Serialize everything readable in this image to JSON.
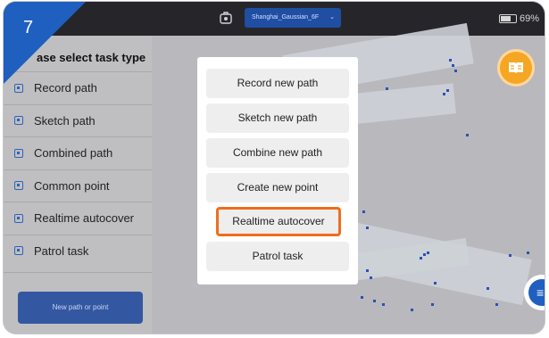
{
  "step_badge": "7",
  "topbar": {
    "map_icon": "robot-map-icon",
    "map_name": "Shanghai_Gaussian_6F",
    "battery_text": "69%"
  },
  "sidebar": {
    "header": "ase select task type",
    "items": [
      {
        "label": "Record path",
        "icon": "task-icon"
      },
      {
        "label": "Sketch path",
        "icon": "task-icon"
      },
      {
        "label": "Combined path",
        "icon": "task-icon"
      },
      {
        "label": "Common point",
        "icon": "task-icon"
      },
      {
        "label": "Realtime autocover",
        "icon": "task-icon"
      },
      {
        "label": "Patrol task",
        "icon": "task-icon"
      }
    ],
    "new_button": "New path or point"
  },
  "modal": {
    "options": [
      "Record new path",
      "Sketch new path",
      "Combine new path",
      "Create new point",
      "Realtime autocover",
      "Patrol task"
    ],
    "highlighted_option": "Realtime autocover"
  },
  "colors": {
    "accent_blue": "#1f5fbf",
    "highlight_orange": "#f06d1a",
    "book_button": "#f5a623"
  },
  "icons": {
    "book": "book-icon",
    "menu": "menu-icon"
  }
}
